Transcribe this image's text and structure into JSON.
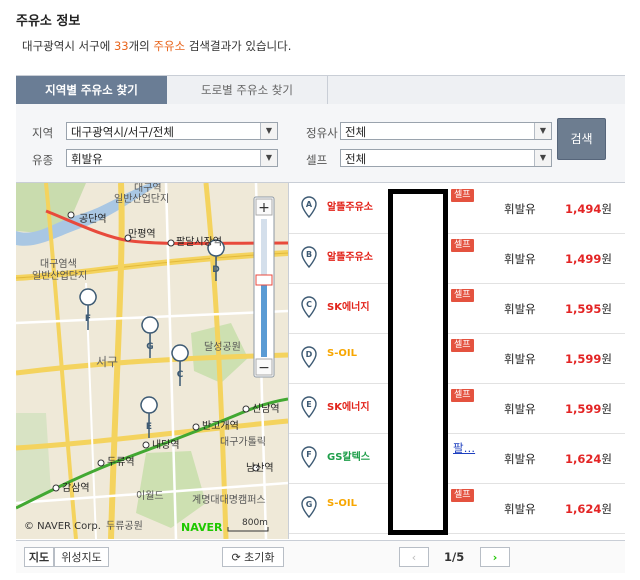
{
  "section_title": "주유소 정보",
  "summary": {
    "prefix": "대구광역시 서구에 ",
    "count": "33",
    "mid1": "개의 ",
    "keyword": "주유소",
    "suffix": " 검색결과가 있습니다."
  },
  "tabs": [
    {
      "label": "지역별 주유소 찾기"
    },
    {
      "label": "도로별 주유소 찾기"
    }
  ],
  "filters": {
    "region_label": "지역",
    "region_value": "대구광역시/서구/전체",
    "brand_label": "정유사",
    "brand_value": "전체",
    "fuel_label": "유종",
    "fuel_value": "휘발유",
    "self_label": "셀프",
    "self_value": "전체",
    "search_label": "검색"
  },
  "map": {
    "labels": [
      "대구역",
      "일반산업단지",
      "공단역",
      "만평역",
      "팔달시장역",
      "대구염색",
      "일반산업단지",
      "서구",
      "달성공원",
      "신남역",
      "반고개역",
      "대구가톨릭",
      "내당역",
      "두류역",
      "남산역",
      "감삼역",
      "이월드",
      "계명대대명캠퍼스",
      "두류공원"
    ],
    "copyright": "© NAVER Corp.",
    "logo": "NAVER",
    "scale": "800m",
    "markers": [
      "A",
      "B",
      "C",
      "D",
      "E",
      "F",
      "G"
    ],
    "map_type_label": "지도",
    "satellite_label": "위성지도",
    "reset_label": "초기화"
  },
  "stations": [
    {
      "marker": "A",
      "brand": "알뜰주유소",
      "brand_color": "#e2231a",
      "self": "셀프",
      "fuel": "휘발유",
      "price": "1,494",
      "won": "원"
    },
    {
      "marker": "B",
      "brand": "알뜰주유소",
      "brand_color": "#e2231a",
      "self": "셀프",
      "fuel": "휘발유",
      "price": "1,499",
      "won": "원"
    },
    {
      "marker": "C",
      "brand": "SK에너지",
      "brand_color": "#e2231a",
      "self": "셀프",
      "fuel": "휘발유",
      "price": "1,595",
      "won": "원"
    },
    {
      "marker": "D",
      "brand": "S-OIL",
      "brand_color": "#f7a600",
      "self": "셀프",
      "fuel": "휘발유",
      "price": "1,599",
      "won": "원"
    },
    {
      "marker": "E",
      "brand": "SK에너지",
      "brand_color": "#e2231a",
      "self": "셀프",
      "fuel": "휘발유",
      "price": "1,599",
      "won": "원"
    },
    {
      "marker": "F",
      "brand": "GS칼텍스",
      "brand_color": "#1e9e4a",
      "self": "",
      "fuel": "휘발유",
      "price": "1,624",
      "won": "원"
    },
    {
      "marker": "G",
      "brand": "S-OIL",
      "brand_color": "#f7a600",
      "self": "셀프",
      "fuel": "휘발유",
      "price": "1,624",
      "won": "원"
    }
  ],
  "ad_link": "팔…",
  "pagination": {
    "current": "1",
    "separator": "/",
    "total": "5",
    "prev": "‹",
    "next": "›"
  }
}
